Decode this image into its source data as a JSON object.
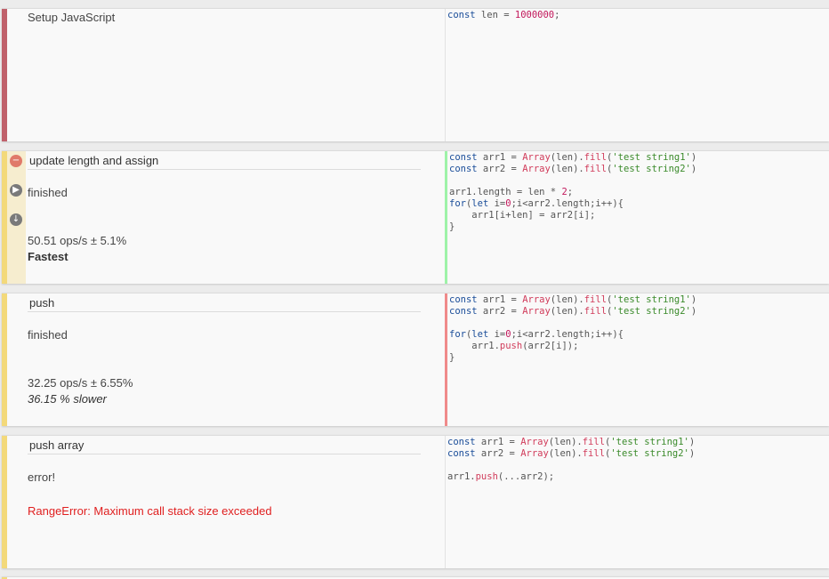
{
  "setup": {
    "title": "Setup JavaScript",
    "code": [
      [
        [
          "kw",
          "const"
        ],
        [
          "pl",
          " len = "
        ],
        [
          "num",
          "1000000"
        ],
        [
          "pl",
          ";"
        ]
      ]
    ]
  },
  "tests": [
    {
      "title": "update length and assign",
      "status": "finished",
      "ops": "50.51 ops/s ± 5.1%",
      "rank": "Fastest",
      "code": [
        [
          [
            "kw",
            "const"
          ],
          [
            "pl",
            " arr1 = "
          ],
          [
            "fn",
            "Array"
          ],
          [
            "pl",
            "(len)."
          ],
          [
            "fn",
            "fill"
          ],
          [
            "pl",
            "("
          ],
          [
            "str",
            "'test string1'"
          ],
          [
            "pl",
            ")"
          ]
        ],
        [
          [
            "kw",
            "const"
          ],
          [
            "pl",
            " arr2 = "
          ],
          [
            "fn",
            "Array"
          ],
          [
            "pl",
            "(len)."
          ],
          [
            "fn",
            "fill"
          ],
          [
            "pl",
            "("
          ],
          [
            "str",
            "'test string2'"
          ],
          [
            "pl",
            ")"
          ]
        ],
        [],
        [
          [
            "pl",
            "arr1.length = len * "
          ],
          [
            "num",
            "2"
          ],
          [
            "pl",
            ";"
          ]
        ],
        [
          [
            "kw",
            "for"
          ],
          [
            "pl",
            "("
          ],
          [
            "kw",
            "let"
          ],
          [
            "pl",
            " i="
          ],
          [
            "num",
            "0"
          ],
          [
            "pl",
            ";i<arr2.length;i++){"
          ]
        ],
        [
          [
            "pl",
            "    arr1[i+len] = arr2[i];"
          ]
        ],
        [
          [
            "pl",
            "}"
          ]
        ]
      ]
    },
    {
      "title": "push",
      "status": "finished",
      "ops": "32.25 ops/s ± 6.55%",
      "rank": "36.15 % slower",
      "code": [
        [
          [
            "kw",
            "const"
          ],
          [
            "pl",
            " arr1 = "
          ],
          [
            "fn",
            "Array"
          ],
          [
            "pl",
            "(len)."
          ],
          [
            "fn",
            "fill"
          ],
          [
            "pl",
            "("
          ],
          [
            "str",
            "'test string1'"
          ],
          [
            "pl",
            ")"
          ]
        ],
        [
          [
            "kw",
            "const"
          ],
          [
            "pl",
            " arr2 = "
          ],
          [
            "fn",
            "Array"
          ],
          [
            "pl",
            "(len)."
          ],
          [
            "fn",
            "fill"
          ],
          [
            "pl",
            "("
          ],
          [
            "str",
            "'test string2'"
          ],
          [
            "pl",
            ")"
          ]
        ],
        [],
        [
          [
            "kw",
            "for"
          ],
          [
            "pl",
            "("
          ],
          [
            "kw",
            "let"
          ],
          [
            "pl",
            " i="
          ],
          [
            "num",
            "0"
          ],
          [
            "pl",
            ";i<arr2.length;i++){"
          ]
        ],
        [
          [
            "pl",
            "    arr1."
          ],
          [
            "fn",
            "push"
          ],
          [
            "pl",
            "(arr2[i]);"
          ]
        ],
        [
          [
            "pl",
            "}"
          ]
        ]
      ]
    },
    {
      "title": "push array",
      "status": "error!",
      "error": "RangeError: Maximum call stack size exceeded",
      "code": [
        [
          [
            "kw",
            "const"
          ],
          [
            "pl",
            " arr1 = "
          ],
          [
            "fn",
            "Array"
          ],
          [
            "pl",
            "(len)."
          ],
          [
            "fn",
            "fill"
          ],
          [
            "pl",
            "("
          ],
          [
            "str",
            "'test string1'"
          ],
          [
            "pl",
            ")"
          ]
        ],
        [
          [
            "kw",
            "const"
          ],
          [
            "pl",
            " arr2 = "
          ],
          [
            "fn",
            "Array"
          ],
          [
            "pl",
            "(len)."
          ],
          [
            "fn",
            "fill"
          ],
          [
            "pl",
            "("
          ],
          [
            "str",
            "'test string2'"
          ],
          [
            "pl",
            ")"
          ]
        ],
        [],
        [
          [
            "pl",
            "arr1."
          ],
          [
            "fn",
            "push"
          ],
          [
            "pl",
            "(...arr2);"
          ]
        ]
      ]
    }
  ],
  "colors": {
    "setup_bar": "#c0616b",
    "test_bar": "#f3d97a",
    "gutter": "#f6edcf",
    "fastest_border": "#9ef2a8",
    "slow_border": "#f08a8a",
    "error_text": "#e02020"
  },
  "icons": {
    "remove": "minus-circle-icon",
    "run": "play-circle-icon",
    "move_down": "arrow-down-circle-icon"
  }
}
